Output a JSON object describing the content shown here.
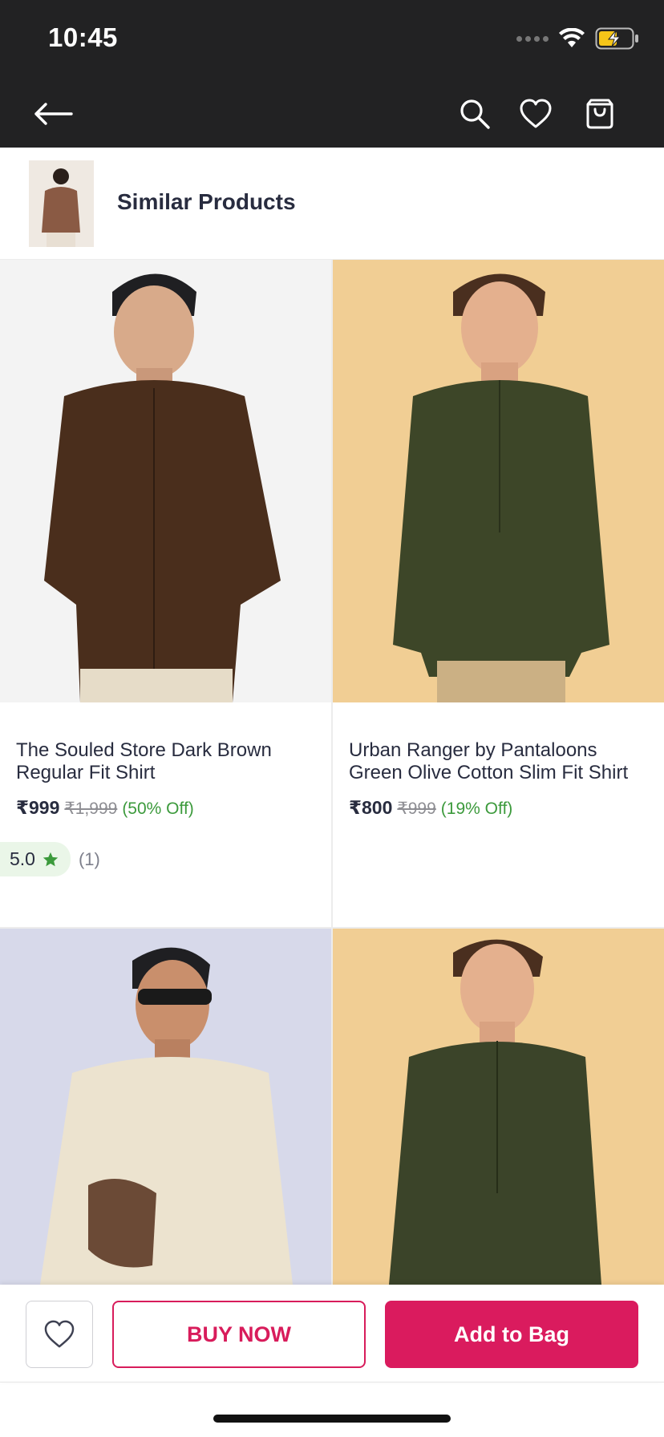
{
  "status_bar": {
    "time": "10:45"
  },
  "app_bar": {
    "back_icon": "arrow-left-icon",
    "icons": [
      "search-icon",
      "heart-icon",
      "bag-icon"
    ]
  },
  "similar": {
    "title": "Similar Products"
  },
  "products": [
    {
      "name": "The Souled Store Dark Brown Regular Fit Shirt",
      "price": "₹999",
      "mrp": "₹1,999",
      "discount": "(50% Off)",
      "rating": "5.0",
      "rating_count": "(1)",
      "shirt_color": "#4a2e1c",
      "bg_color": "#f3f3f3"
    },
    {
      "name": "Urban Ranger by Pantaloons Green Olive Cotton Slim Fit Shirt",
      "price": "₹800",
      "mrp": "₹999",
      "discount": "(19% Off)",
      "shirt_color": "#3d4628",
      "bg_color": "#f1ce94"
    },
    {
      "shirt_color": "#ece3cf",
      "bg_color": "#d7d9ea"
    },
    {
      "shirt_color": "#3b4429",
      "bg_color": "#f1ce94"
    }
  ],
  "actions": {
    "buy_now": "BUY NOW",
    "add_to_bag": "Add to Bag"
  },
  "colors": {
    "accent": "#da1b5e",
    "dark_bar": "#222223",
    "discount_green": "#3c9a3c"
  }
}
